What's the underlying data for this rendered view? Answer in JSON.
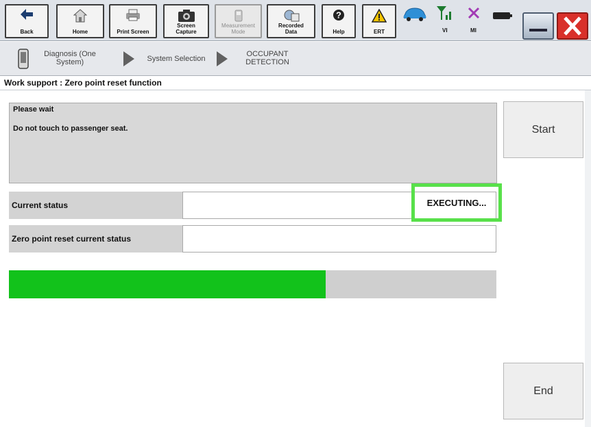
{
  "toolbar": {
    "back_label": "Back",
    "home_label": "Home",
    "print_label": "Print Screen",
    "capture_label": "Screen Capture",
    "measurement_label": "Measurement Mode",
    "recorded_label": "Recorded Data",
    "help_label": "Help",
    "ert_label": "ERT",
    "vi_label": "VI",
    "mi_label": "MI",
    "icons": [
      "back-arrow-icon",
      "home-icon",
      "printer-icon",
      "camera-icon",
      "meter-icon",
      "recorded-data-icon",
      "help-icon",
      "warning-icon",
      "car-icon",
      "signal-icon",
      "x-mark-icon",
      "battery-icon",
      "minimize-icon",
      "close-icon"
    ]
  },
  "breadcrumb": {
    "step1": "Diagnosis (One System)",
    "step2": "System Selection",
    "step3": "OCCUPANT DETECTION"
  },
  "page_title": "Work support : Zero point reset function",
  "message": {
    "line1": "Please  wait",
    "line2": "Do not touch to passenger seat."
  },
  "rows": {
    "current_status_label": "Current status",
    "current_status_value": "EXECUTING...",
    "zero_point_label": "Zero point reset current status",
    "zero_point_value": ""
  },
  "progress": {
    "fraction": 0.65,
    "fill_color": "#12c21b"
  },
  "buttons": {
    "start": "Start",
    "end": "End"
  },
  "colors": {
    "highlight": "#58e04a",
    "close_button": "#d9302a"
  }
}
